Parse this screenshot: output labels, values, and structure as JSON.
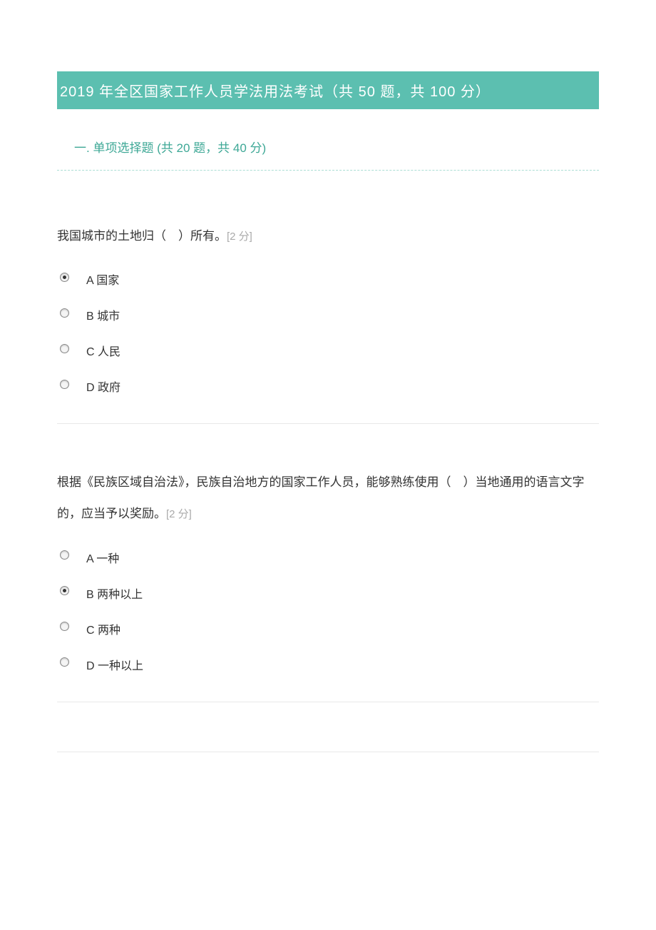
{
  "header": {
    "title": "2019 年全区国家工作人员学法用法考试（共 50 题，共 100 分）"
  },
  "section": {
    "title": "一. 单项选择题 (共 20 题，共 40 分)"
  },
  "questions": [
    {
      "text": "我国城市的土地归（　）所有。",
      "points": "[2 分]",
      "selected": 0,
      "options": [
        "A 国家",
        "B 城市",
        "C 人民",
        "D 政府"
      ]
    },
    {
      "text": "根据《民族区域自治法》，民族自治地方的国家工作人员，能够熟练使用（　）当地通用的语言文字的，应当予以奖励。",
      "points": "[2 分]",
      "selected": 1,
      "options": [
        "A 一种",
        "B 两种以上",
        "C 两种",
        "D 一种以上"
      ]
    }
  ]
}
